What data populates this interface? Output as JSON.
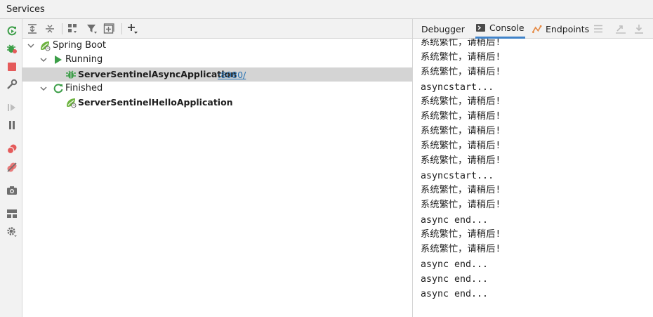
{
  "window": {
    "title": "Services"
  },
  "colors": {
    "accent": "#4083c9",
    "link": "#2470b3",
    "run_green": "#3c9e48",
    "stop_red": "#e55b5b"
  },
  "toolbar_icons": [
    "expand-all-icon",
    "collapse-all-icon",
    "group-by-icon",
    "filter-icon",
    "new-tab-icon",
    "add-service-icon"
  ],
  "leftbar_icons": [
    "rerun-icon",
    "debug-icon",
    "stop-icon",
    "settings-wrench-icon",
    "resume-icon",
    "pause-icon",
    "view-breakpoints-icon",
    "mute-breakpoints-icon",
    "camera-icon",
    "layout-icon",
    "gear-icon"
  ],
  "tree": {
    "spring_boot": {
      "label": "Spring Boot"
    },
    "running": {
      "label": "Running"
    },
    "async_app": {
      "label": "ServerSentinelAsyncApplication",
      "port": ":8080/"
    },
    "finished": {
      "label": "Finished"
    },
    "hello_app": {
      "label": "ServerSentinelHelloApplication"
    }
  },
  "tabs": {
    "debugger": {
      "label": "Debugger"
    },
    "console": {
      "label": "Console"
    },
    "endpoints": {
      "label": "Endpoints"
    }
  },
  "console_lines": [
    "系统繁忙，请稍后!",
    "系统繁忙，请稍后!",
    "系统繁忙，请稍后!",
    "asyncstart...",
    "系统繁忙，请稍后!",
    "系统繁忙，请稍后!",
    "系统繁忙，请稍后!",
    "系统繁忙，请稍后!",
    "系统繁忙，请稍后!",
    "asyncstart...",
    "系统繁忙，请稍后!",
    "系统繁忙，请稍后!",
    "async end...",
    "系统繁忙，请稍后!",
    "系统繁忙，请稍后!",
    "async end...",
    "async end...",
    "async end..."
  ]
}
